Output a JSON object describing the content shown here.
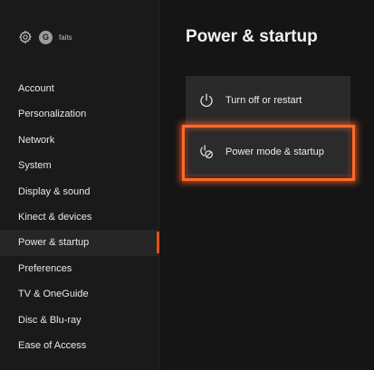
{
  "profile": {
    "avatar_letter": "G",
    "gamertag": "faits"
  },
  "sidebar": {
    "items": [
      {
        "label": "Account"
      },
      {
        "label": "Personalization"
      },
      {
        "label": "Network"
      },
      {
        "label": "System"
      },
      {
        "label": "Display & sound"
      },
      {
        "label": "Kinect & devices"
      },
      {
        "label": "Power & startup",
        "selected": true
      },
      {
        "label": "Preferences"
      },
      {
        "label": "TV & OneGuide"
      },
      {
        "label": "Disc & Blu-ray"
      },
      {
        "label": "Ease of Access"
      }
    ]
  },
  "main": {
    "title": "Power & startup",
    "tiles": [
      {
        "label": "Turn off or restart",
        "icon": "power-icon"
      },
      {
        "label": "Power mode & startup",
        "icon": "power-mode-icon",
        "highlighted": true
      }
    ]
  },
  "colors": {
    "accent": "#e04e1f",
    "highlight": "#ff6a2a",
    "background": "#151515",
    "sidebar": "#1a1a1a",
    "tile": "#2a2a2a"
  }
}
